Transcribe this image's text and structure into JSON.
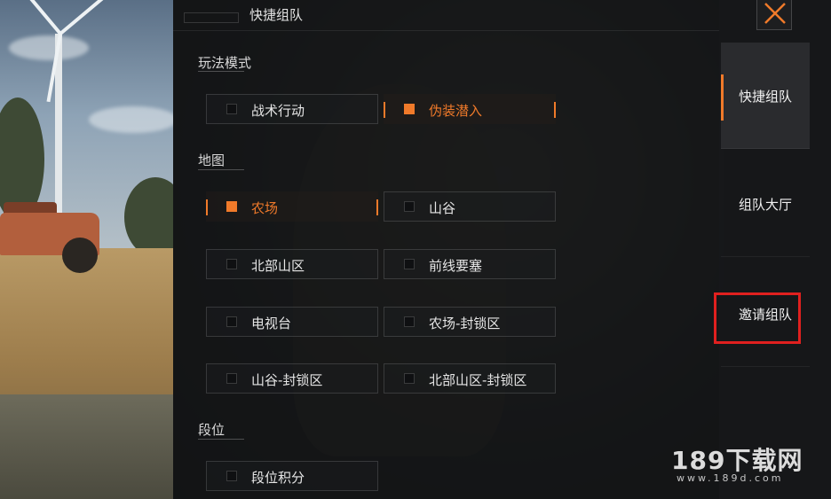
{
  "header": {
    "title": "快捷组队"
  },
  "sections": {
    "mode": {
      "label": "玩法模式",
      "options": [
        {
          "label": "战术行动",
          "selected": false
        },
        {
          "label": "伪装潜入",
          "selected": true
        }
      ]
    },
    "map": {
      "label": "地图",
      "options": [
        {
          "label": "农场",
          "selected": true
        },
        {
          "label": "山谷",
          "selected": false
        },
        {
          "label": "北部山区",
          "selected": false
        },
        {
          "label": "前线要塞",
          "selected": false
        },
        {
          "label": "电视台",
          "selected": false
        },
        {
          "label": "农场-封锁区",
          "selected": false
        },
        {
          "label": "山谷-封锁区",
          "selected": false
        },
        {
          "label": "北部山区-封锁区",
          "selected": false
        }
      ]
    },
    "rank": {
      "label": "段位",
      "options": [
        {
          "label": "段位积分",
          "selected": false
        }
      ]
    }
  },
  "tabs": [
    {
      "label": "快捷组队",
      "active": true
    },
    {
      "label": "组队大厅",
      "active": false
    },
    {
      "label": "邀请组队",
      "active": false,
      "highlighted": true
    }
  ],
  "close_icon": "close-icon",
  "watermark": {
    "main": "189下载网",
    "sub": "www.189d.com"
  },
  "colors": {
    "accent": "#f07a2a",
    "highlight_frame": "#e0201f"
  }
}
